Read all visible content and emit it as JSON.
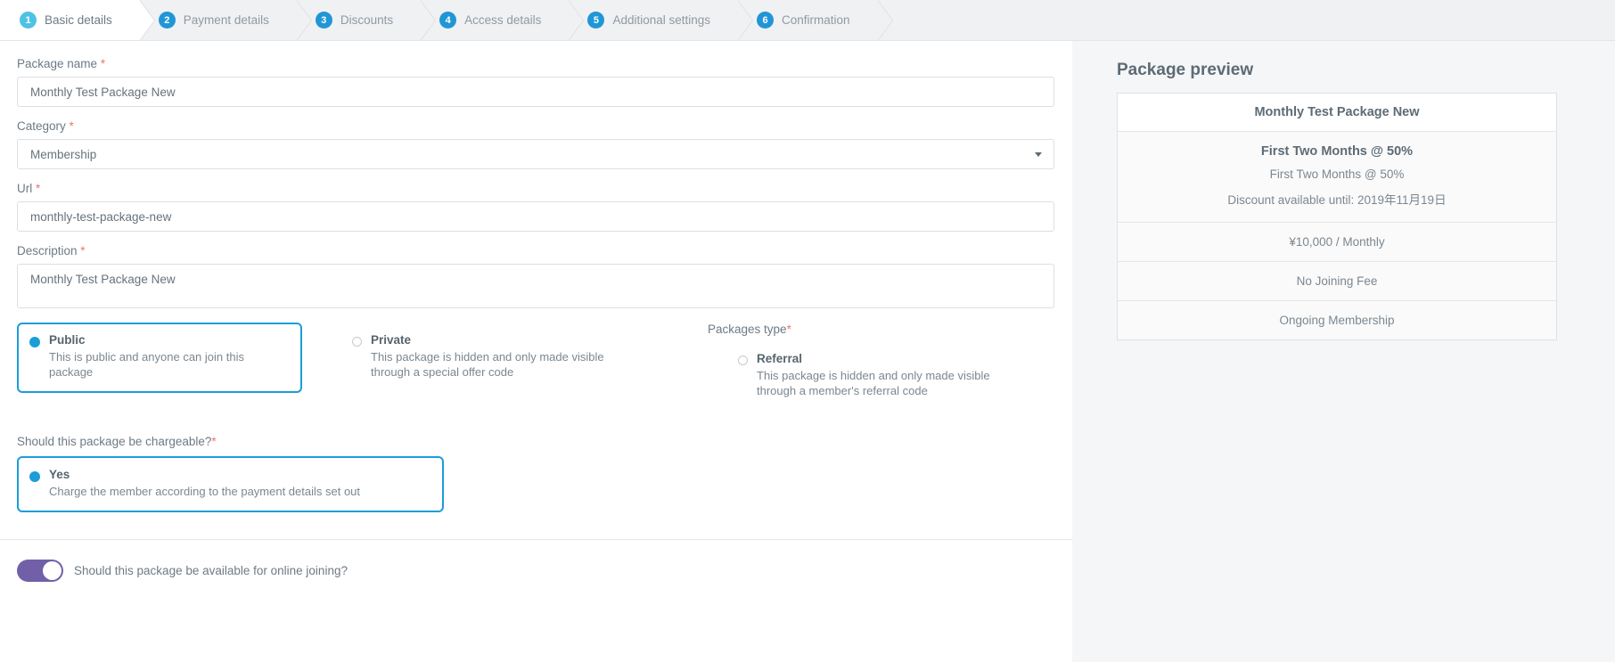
{
  "wizard": {
    "steps": [
      {
        "num": "1",
        "label": "Basic details",
        "active": true
      },
      {
        "num": "2",
        "label": "Payment details",
        "active": false
      },
      {
        "num": "3",
        "label": "Discounts",
        "active": false
      },
      {
        "num": "4",
        "label": "Access details",
        "active": false
      },
      {
        "num": "5",
        "label": "Additional settings",
        "active": false
      },
      {
        "num": "6",
        "label": "Confirmation",
        "active": false
      }
    ]
  },
  "form": {
    "package_name": {
      "label": "Package name",
      "required_mark": "*",
      "value": "Monthly Test Package New"
    },
    "category": {
      "label": "Category",
      "required_mark": "*",
      "value": "Membership"
    },
    "url": {
      "label": "Url",
      "required_mark": "*",
      "value": "monthly-test-package-new"
    },
    "description": {
      "label": "Description",
      "required_mark": "*",
      "value": "Monthly Test Package New"
    },
    "visibility": {
      "public": {
        "title": "Public",
        "desc": "This is public and anyone can join this package",
        "selected": true
      },
      "private": {
        "title": "Private",
        "desc": "This package is hidden and only made visible through a special offer code",
        "selected": false
      }
    },
    "packages_type": {
      "label": "Packages type",
      "required_mark": "*",
      "referral": {
        "title": "Referral",
        "desc": "This package is hidden and only made visible through a member's referral code",
        "selected": false
      }
    },
    "chargeable": {
      "label": "Should this package be chargeable?",
      "required_mark": "*",
      "yes": {
        "title": "Yes",
        "desc": "Charge the member according to the payment details set out",
        "selected": true
      }
    },
    "online_joining": {
      "label": "Should this package be available for online joining?",
      "on": true
    }
  },
  "preview": {
    "title": "Package preview",
    "package_name": "Monthly Test Package New",
    "discount_title": "First Two Months @ 50%",
    "discount_subtitle": "First Two Months @ 50%",
    "discount_until": "Discount available until: 2019年11月19日",
    "price": "¥10,000 / Monthly",
    "joining_fee": "No Joining Fee",
    "term": "Ongoing Membership"
  },
  "colors": {
    "accent_blue": "#1b9dd9",
    "step_active": "#4fc1e5",
    "step_inactive": "#2196d6",
    "toggle_on": "#7160a8",
    "required_red": "#e8776f"
  }
}
